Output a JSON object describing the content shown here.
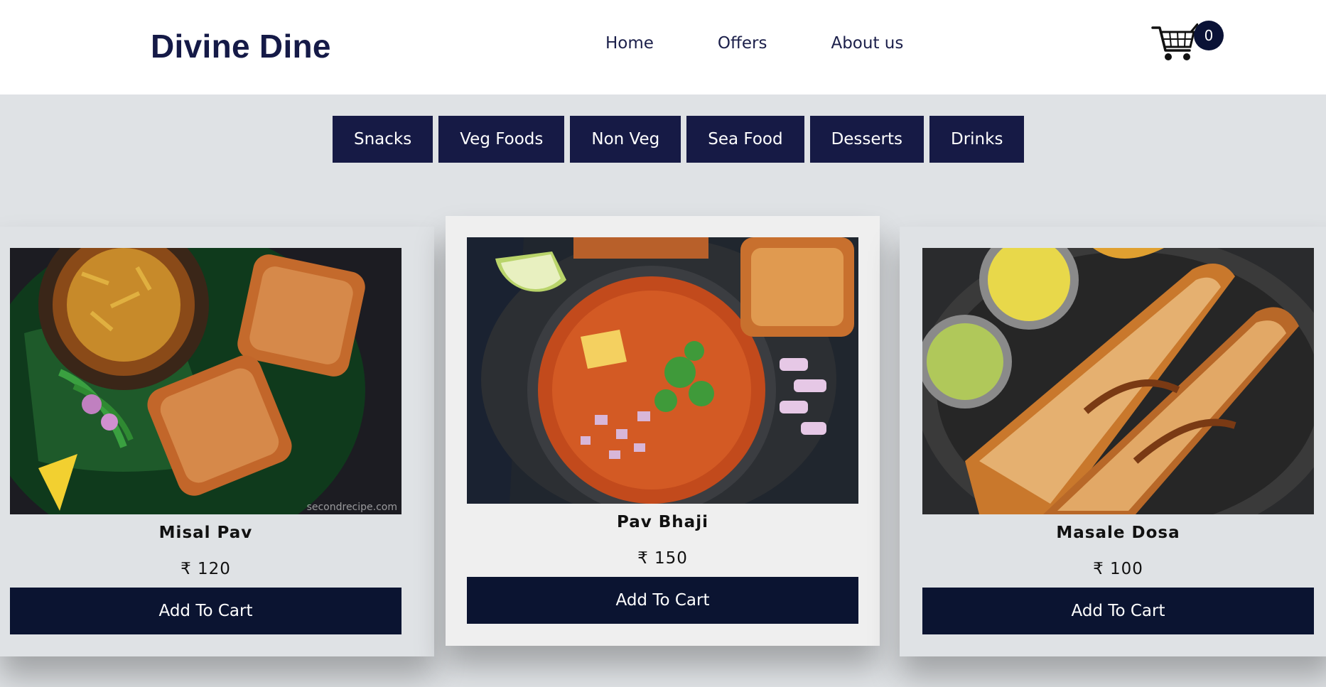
{
  "header": {
    "brand": "Divine Dine",
    "nav": [
      "Home",
      "Offers",
      "About us"
    ],
    "cart_count": "0",
    "cart_icon": "shopping-cart-icon"
  },
  "categories": [
    "Snacks",
    "Veg Foods",
    "Non Veg",
    "Sea Food",
    "Desserts",
    "Drinks"
  ],
  "products": [
    {
      "name": "Misal Pav",
      "price": "₹ 120",
      "button": "Add To Cart",
      "watermark": "secondrecipe.com"
    },
    {
      "name": "Pav Bhaji",
      "price": "₹ 150",
      "button": "Add To Cart"
    },
    {
      "name": "Masale Dosa",
      "price": "₹ 100",
      "button": "Add To Cart"
    }
  ],
  "colors": {
    "brand": "#151a47",
    "category_bg": "#161a45",
    "button_bg": "#0b1431",
    "page_bg": "#dfe2e5"
  }
}
